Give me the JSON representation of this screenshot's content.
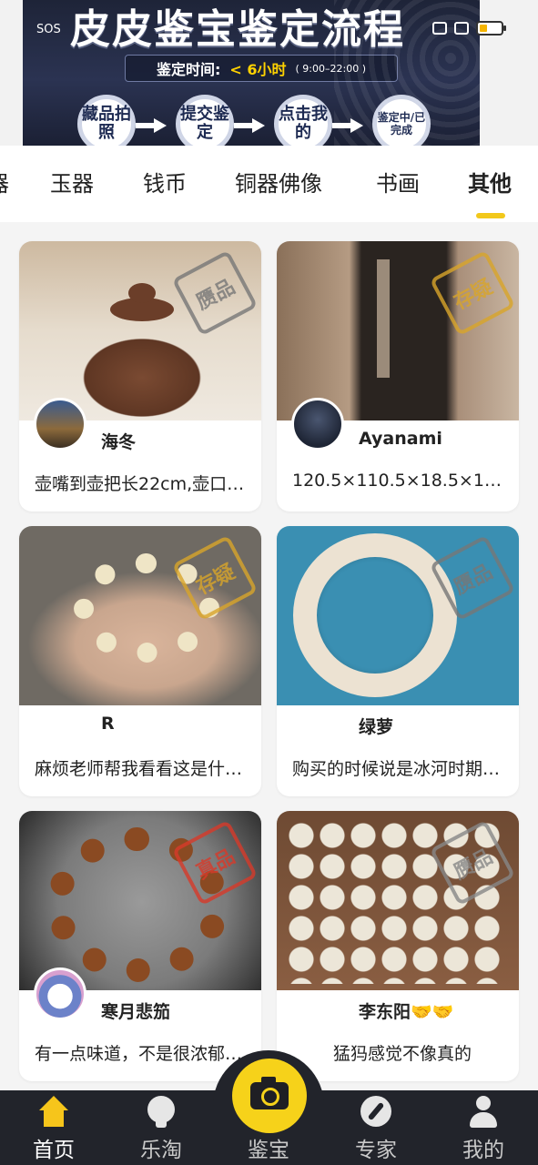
{
  "status_bar": {
    "left_text": "SOS"
  },
  "banner": {
    "title": "皮皮鉴宝鉴定流程",
    "time_label": "鉴定时间:",
    "time_value": "< 6小时",
    "time_hours": "( 9:00–22:00 )",
    "steps": [
      "藏品拍照",
      "提交鉴定",
      "点击我的",
      "鉴定中/已完成"
    ]
  },
  "tabs": {
    "items": [
      "器",
      "玉器",
      "钱币",
      "铜器佛像",
      "书画",
      "其他"
    ],
    "active_index": 5
  },
  "cards": [
    {
      "name": "海冬",
      "desc": "壶嘴到壶把长22cm,壶口…",
      "stamp": "赝品",
      "stamp_color": "#666666"
    },
    {
      "name": "Ayanami",
      "desc": "120.5×110.5×18.5×12.5c…",
      "stamp": "存疑",
      "stamp_color": "#d9a52a"
    },
    {
      "name": "R",
      "desc": "麻烦老师帮我看看这是什…",
      "stamp": "存疑",
      "stamp_color": "#d9a52a"
    },
    {
      "name": "绿萝",
      "desc": "购买的时候说是冰河时期…",
      "stamp": "赝品",
      "stamp_color": "#666666"
    },
    {
      "name": "寒月悲笳",
      "desc": "有一点味道，不是很浓郁…",
      "stamp": "真品",
      "stamp_color": "#d83a2a"
    },
    {
      "name": "李东阳🤝🤝",
      "desc": "猛犸感觉不像真的",
      "stamp": "赝品",
      "stamp_color": "#666666"
    }
  ],
  "bottom_nav": {
    "items": [
      "首页",
      "乐淘",
      "鉴宝",
      "专家",
      "我的"
    ],
    "active_index": 0
  },
  "colors": {
    "accent": "#f6d21a",
    "nav_bg": "#22242b"
  }
}
